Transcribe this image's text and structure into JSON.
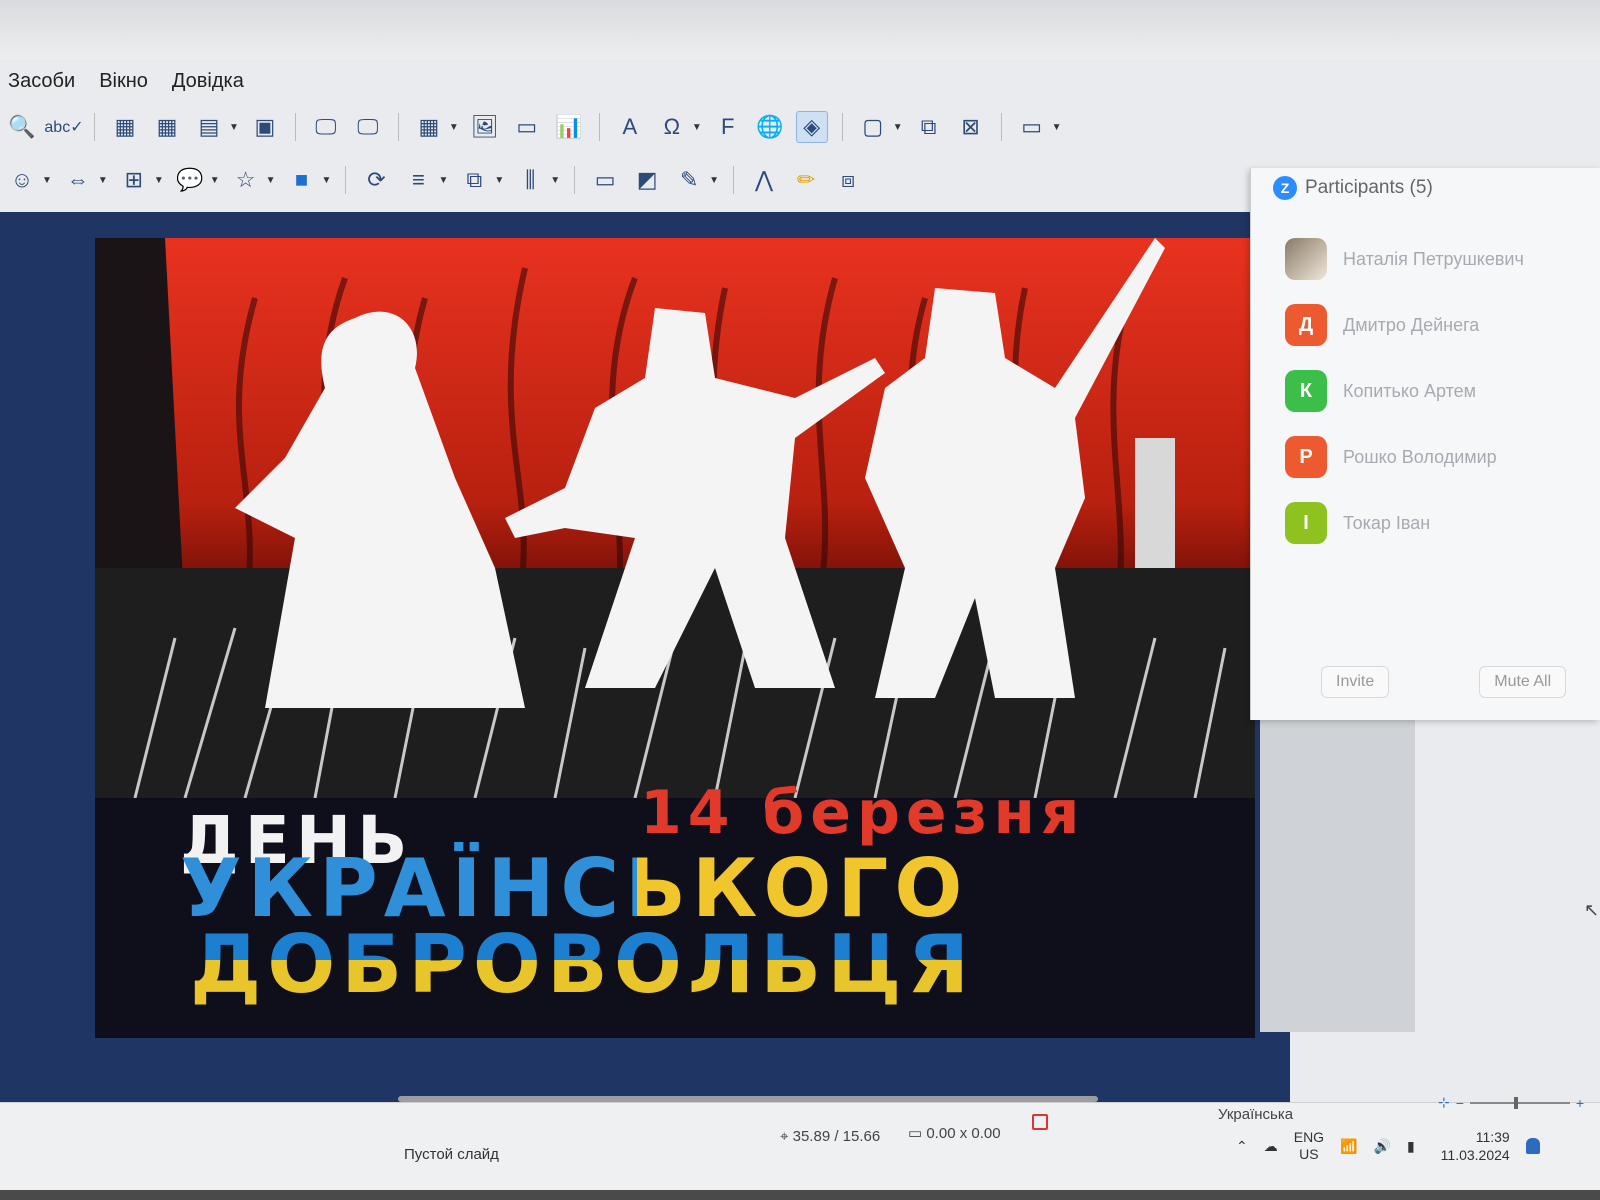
{
  "menu": {
    "items": [
      "Засоби",
      "Вікно",
      "Довідка"
    ]
  },
  "slide": {
    "line1_left": "ДЕНЬ",
    "line1_right": "14 березня",
    "line2": "УКРАЇНСЬКОГО",
    "line3": "ДОБРОВОЛЬЦЯ"
  },
  "participants": {
    "title": "Participants (5)",
    "items": [
      {
        "name": "Наталія Петрушкевич",
        "initial": "",
        "color": ""
      },
      {
        "name": "Дмитро Дейнега",
        "initial": "Д",
        "color": "#ee5a2f"
      },
      {
        "name": "Копитько Артем",
        "initial": "К",
        "color": "#3cbf4a"
      },
      {
        "name": "Рошко Володимир",
        "initial": "Р",
        "color": "#ee5a2f"
      },
      {
        "name": "Токар Іван",
        "initial": "І",
        "color": "#8dc21f"
      }
    ],
    "invite_label": "Invite",
    "mute_all_label": "Mute All"
  },
  "status": {
    "slide_name": "Пустой слайд",
    "position": "35.89 / 15.66",
    "size": "0.00 x 0.00",
    "language": "Українська"
  },
  "tray": {
    "lang1": "ENG",
    "lang2": "US",
    "time": "11:39",
    "date": "11.03.2024"
  }
}
